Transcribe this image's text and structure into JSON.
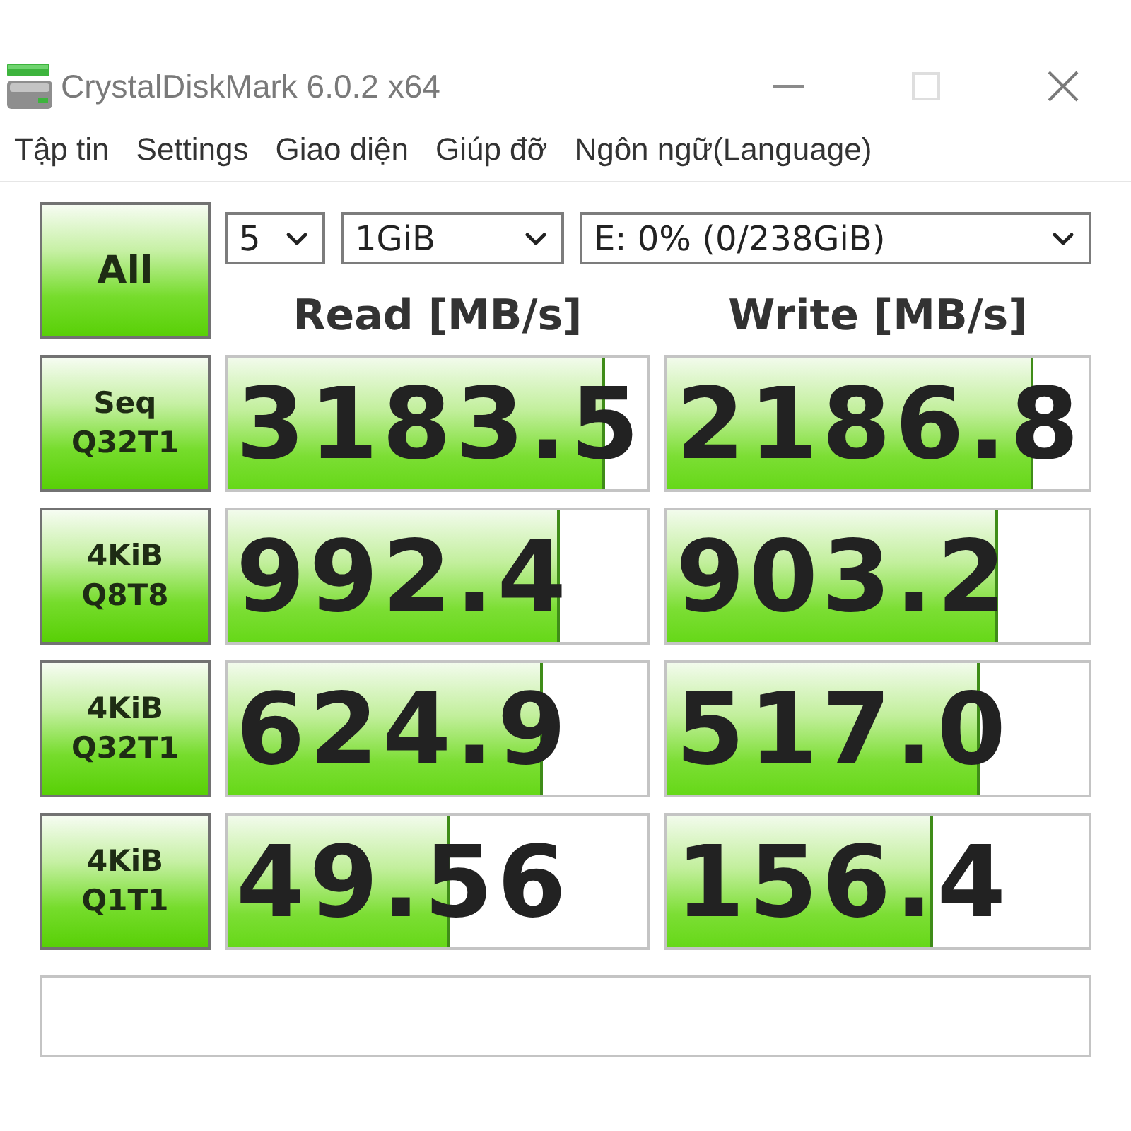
{
  "window": {
    "title": "CrystalDiskMark 6.0.2 x64"
  },
  "menu": [
    "Tập tin",
    "Settings",
    "Giao diện",
    "Giúp đỡ",
    "Ngôn ngữ(Language)"
  ],
  "all_button": {
    "label": "All"
  },
  "selectors": [
    {
      "kind": "count",
      "value": "5"
    },
    {
      "kind": "size",
      "value": "1GiB"
    },
    {
      "kind": "drive",
      "value": "E: 0% (0/238GiB)"
    }
  ],
  "columns": [
    "Read [MB/s]",
    "Write [MB/s]"
  ],
  "tests": [
    {
      "name": "Seq",
      "detail": "Q32T1",
      "read": {
        "value": "3183.5",
        "level": 0.9
      },
      "write": {
        "value": "2186.8",
        "level": 0.87
      }
    },
    {
      "name": "4KiB",
      "detail": "Q8T8",
      "read": {
        "value": "992.4",
        "level": 0.79
      },
      "write": {
        "value": "903.2",
        "level": 0.785
      }
    },
    {
      "name": "4KiB",
      "detail": "Q32T1",
      "read": {
        "value": "624.9",
        "level": 0.75
      },
      "write": {
        "value": "517.0",
        "level": 0.74
      }
    },
    {
      "name": "4KiB",
      "detail": "Q1T1",
      "read": {
        "value": "49.56",
        "level": 0.527
      },
      "write": {
        "value": "156.4",
        "level": 0.63
      }
    }
  ]
}
